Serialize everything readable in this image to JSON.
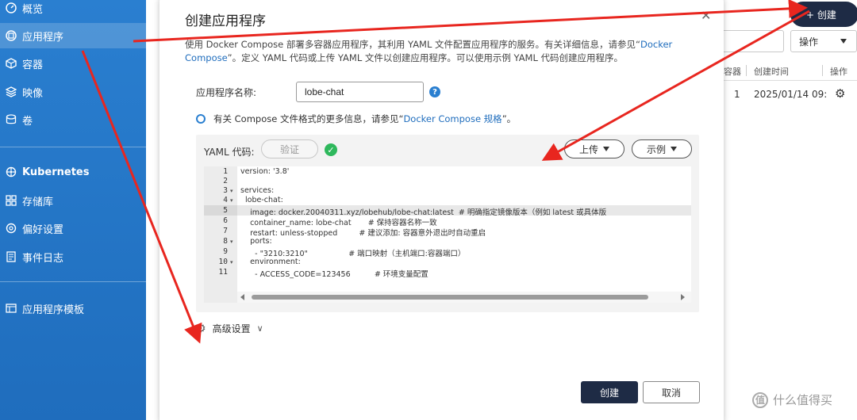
{
  "sidebar": {
    "items": [
      {
        "label": "概览",
        "icon": "overview-icon"
      },
      {
        "label": "应用程序",
        "icon": "apps-icon"
      },
      {
        "label": "容器",
        "icon": "container-icon"
      },
      {
        "label": "映像",
        "icon": "image-icon"
      },
      {
        "label": "卷",
        "icon": "volume-icon"
      },
      {
        "label": "Kubernetes",
        "icon": "kubernetes-icon"
      },
      {
        "label": "存储库",
        "icon": "repository-icon"
      },
      {
        "label": "偏好设置",
        "icon": "settings-icon"
      },
      {
        "label": "事件日志",
        "icon": "log-icon"
      },
      {
        "label": "应用程序模板",
        "icon": "template-icon"
      }
    ],
    "active_index": 1
  },
  "background": {
    "create_button": "+ 创建",
    "ops_select": "操作",
    "table_headers": [
      "容器",
      "创建时间",
      "操作"
    ],
    "row": {
      "containers": "1",
      "created": "2025/01/14 09:"
    }
  },
  "dialog": {
    "title": "创建应用程序",
    "description_1": "使用 Docker Compose 部署多容器应用程序，其利用 YAML 文件配置应用程序的服务。有关详细信息，请参见“",
    "description_link": "Docker Compose",
    "description_2": "”。定义 YAML 代码或上传 YAML 文件以创建应用程序。可以使用示例 YAML 代码创建应用程序。",
    "name_label": "应用程序名称:",
    "name_value": "lobe-chat",
    "info_text": "有关 Compose 文件格式的更多信息，请参见“",
    "info_link": "Docker Compose 规格",
    "info_end": "”。",
    "yaml_label": "YAML 代码:",
    "verify_button": "验证",
    "upload_button": "上传",
    "example_button": "示例",
    "advanced_label": "高级设置",
    "create_button": "创建",
    "cancel_button": "取消"
  },
  "code_lines": [
    {
      "n": "1",
      "text": "version: '3.8'"
    },
    {
      "n": "2",
      "text": ""
    },
    {
      "n": "3",
      "text": "services:"
    },
    {
      "n": "4",
      "text": "  lobe-chat:"
    },
    {
      "n": "5",
      "text": "    image: docker.20040311.xyz/lobehub/lobe-chat:latest  # 明确指定镜像版本（例如 latest 或具体版"
    },
    {
      "n": "6",
      "text": "    container_name: lobe-chat       # 保持容器名称一致"
    },
    {
      "n": "7",
      "text": "    restart: unless-stopped         # 建议添加: 容器意外退出时自动重启"
    },
    {
      "n": "8",
      "text": "    ports:"
    },
    {
      "n": "9",
      "text": "      - \"3210:3210\"                 # 端口映射（主机端口:容器端口）"
    },
    {
      "n": "10",
      "text": "    environment:"
    },
    {
      "n": "11",
      "text": "      - ACCESS_CODE=123456          # 环境变量配置"
    }
  ],
  "watermark": "什么值得买",
  "colors": {
    "sidebar": "#1f6dbd",
    "primary_dark": "#1e2b45",
    "link": "#1f6dbd",
    "ok": "#2eb85c",
    "annotation": "#e8261f"
  }
}
